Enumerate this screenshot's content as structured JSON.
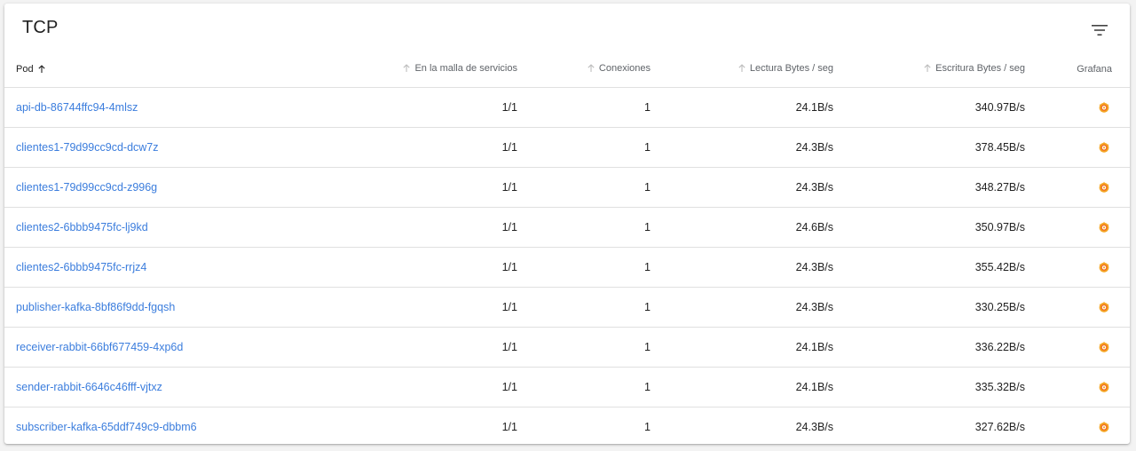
{
  "panel": {
    "title": "TCP"
  },
  "columns": {
    "pod": "Pod",
    "mesh": "En la malla de servicios",
    "connections": "Conexiones",
    "read": "Lectura Bytes / seg",
    "write": "Escritura Bytes / seg",
    "grafana": "Grafana"
  },
  "sort": {
    "column": "pod",
    "direction": "asc"
  },
  "colors": {
    "link": "#3b7ddd",
    "grafana_orange": "#f5a623"
  },
  "rows": [
    {
      "pod": "api-db-86744ffc94-4mlsz",
      "mesh": "1/1",
      "connections": "1",
      "read": "24.1B/s",
      "write": "340.97B/s"
    },
    {
      "pod": "clientes1-79d99cc9cd-dcw7z",
      "mesh": "1/1",
      "connections": "1",
      "read": "24.3B/s",
      "write": "378.45B/s"
    },
    {
      "pod": "clientes1-79d99cc9cd-z996g",
      "mesh": "1/1",
      "connections": "1",
      "read": "24.3B/s",
      "write": "348.27B/s"
    },
    {
      "pod": "clientes2-6bbb9475fc-lj9kd",
      "mesh": "1/1",
      "connections": "1",
      "read": "24.6B/s",
      "write": "350.97B/s"
    },
    {
      "pod": "clientes2-6bbb9475fc-rrjz4",
      "mesh": "1/1",
      "connections": "1",
      "read": "24.3B/s",
      "write": "355.42B/s"
    },
    {
      "pod": "publisher-kafka-8bf86f9dd-fgqsh",
      "mesh": "1/1",
      "connections": "1",
      "read": "24.3B/s",
      "write": "330.25B/s"
    },
    {
      "pod": "receiver-rabbit-66bf677459-4xp6d",
      "mesh": "1/1",
      "connections": "1",
      "read": "24.1B/s",
      "write": "336.22B/s"
    },
    {
      "pod": "sender-rabbit-6646c46fff-vjtxz",
      "mesh": "1/1",
      "connections": "1",
      "read": "24.1B/s",
      "write": "335.32B/s"
    },
    {
      "pod": "subscriber-kafka-65ddf749c9-dbbm6",
      "mesh": "1/1",
      "connections": "1",
      "read": "24.3B/s",
      "write": "327.62B/s"
    }
  ]
}
